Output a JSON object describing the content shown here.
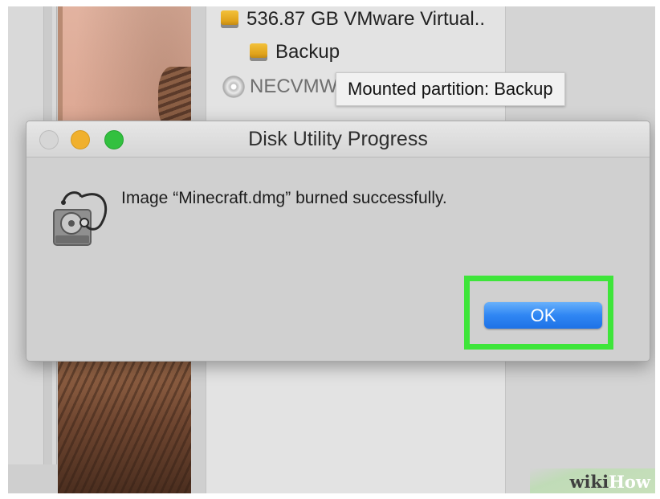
{
  "sidebar": {
    "items": [
      {
        "label": "536.87 GB VMware Virtual..",
        "icon": "external-disk-icon"
      },
      {
        "label": "Backup",
        "icon": "volume-icon"
      },
      {
        "label": "NECVMW",
        "icon": "optical-disc-icon"
      }
    ]
  },
  "tooltip": {
    "text": "Mounted partition: Backup"
  },
  "dialog": {
    "title": "Disk Utility Progress",
    "message": "Image “Minecraft.dmg” burned successfully.",
    "ok_label": "OK",
    "icon": "disk-utility-icon",
    "highlight_color": "#3ee53a",
    "button_color": "#2f86f3"
  },
  "watermark": {
    "part1": "wiki",
    "part2": "How"
  }
}
